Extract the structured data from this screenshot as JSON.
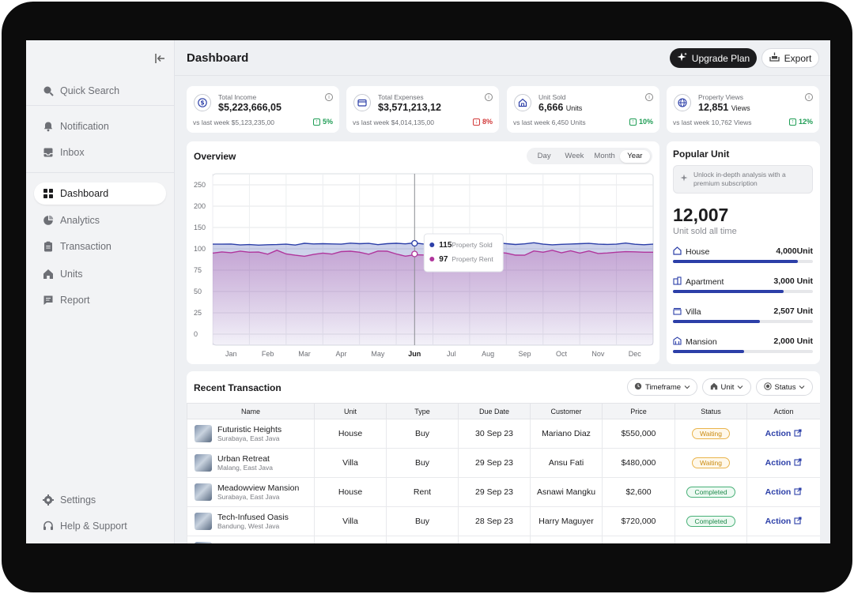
{
  "sidebar": {
    "items": [
      {
        "label": "Quick Search",
        "icon": "search-icon"
      },
      {
        "label": "Notification",
        "icon": "bell-icon"
      },
      {
        "label": "Inbox",
        "icon": "inbox-icon"
      },
      {
        "label": "Dashboard",
        "icon": "grid-icon",
        "active": true
      },
      {
        "label": "Analytics",
        "icon": "pie-chart-icon"
      },
      {
        "label": "Transaction",
        "icon": "clipboard-icon"
      },
      {
        "label": "Units",
        "icon": "home-icon"
      },
      {
        "label": "Report",
        "icon": "message-icon"
      }
    ],
    "footer": [
      {
        "label": "Settings",
        "icon": "gear-icon"
      },
      {
        "label": "Help & Support",
        "icon": "headset-icon"
      }
    ]
  },
  "header": {
    "title": "Dashboard",
    "upgrade_label": "Upgrade Plan",
    "export_label": "Export"
  },
  "stats": [
    {
      "label": "Total Income",
      "value": "$5,223,666,05",
      "unit": "",
      "compare": "vs last week $5,123,235,00",
      "change": "5%",
      "direction": "up",
      "icon": "dollar-icon"
    },
    {
      "label": "Total Expenses",
      "value": "$3,571,213,12",
      "unit": "",
      "compare": "vs last week $4,014,135,00",
      "change": "8%",
      "direction": "down",
      "icon": "wallet-icon"
    },
    {
      "label": "Unit Sold",
      "value": "6,666",
      "unit": "Units",
      "compare": "vs last week 6,450 Units",
      "change": "10%",
      "direction": "up",
      "icon": "house-icon"
    },
    {
      "label": "Property Views",
      "value": "12,851",
      "unit": "Views",
      "compare": "vs last week 10,762 Views",
      "change": "12%",
      "direction": "up",
      "icon": "globe-icon"
    }
  ],
  "overview": {
    "title": "Overview",
    "timeframes": [
      "Day",
      "Week",
      "Month",
      "Year"
    ],
    "active_timeframe": "Year",
    "tooltip": {
      "sold_value": "115",
      "sold_label": "Property Sold",
      "rent_value": "97",
      "rent_label": "Property Rent"
    }
  },
  "chart_data": {
    "type": "area",
    "title": "Overview",
    "xlabel": "",
    "ylabel": "",
    "categories": [
      "Jan",
      "Feb",
      "Mar",
      "Apr",
      "May",
      "Jun",
      "Jul",
      "Aug",
      "Sep",
      "Oct",
      "Nov",
      "Dec"
    ],
    "yticks": [
      0,
      25,
      50,
      75,
      100,
      150,
      200,
      250
    ],
    "ylim": [
      0,
      250
    ],
    "grid": true,
    "highlight": "Jun",
    "colors": {
      "sold": "#2c3fa8",
      "rent": "#b0359c"
    },
    "series": [
      {
        "name": "Property Sold",
        "values": [
          111,
          110,
          111,
          112,
          112,
          113,
          112,
          112,
          112,
          111,
          112,
          111
        ]
      },
      {
        "name": "Property Rent",
        "values": [
          95,
          96,
          94,
          95,
          96,
          94,
          95,
          96,
          95,
          96,
          95,
          96
        ]
      }
    ]
  },
  "popular": {
    "title": "Popular Unit",
    "promo": "Unlock in-depth analysis with a premium subscription",
    "total": "12,007",
    "total_label": "Unit sold all time",
    "units": [
      {
        "name": "House",
        "value": "4,000Unit",
        "fraction": 0.89,
        "icon": "house-icon"
      },
      {
        "name": "Apartment",
        "value": "3,000 Unit",
        "fraction": 0.79,
        "icon": "building-icon"
      },
      {
        "name": "Villa",
        "value": "2,507 Unit",
        "fraction": 0.62,
        "icon": "villa-icon"
      },
      {
        "name": "Mansion",
        "value": "2,000 Unit",
        "fraction": 0.51,
        "icon": "mansion-icon"
      }
    ]
  },
  "recent": {
    "title": "Recent Transaction",
    "filters": [
      "Timeframe",
      "Unit",
      "Status"
    ],
    "columns": [
      "Name",
      "Unit",
      "Type",
      "Due Date",
      "Customer",
      "Price",
      "Status",
      "Action"
    ],
    "rows": [
      {
        "name": "Futuristic Heights",
        "location": "Surabaya, East Java",
        "unit": "House",
        "type": "Buy",
        "due": "30 Sep 23",
        "customer": "Mariano Diaz",
        "price": "$550,000",
        "status": "Waiting",
        "action": "Action"
      },
      {
        "name": "Urban Retreat",
        "location": "Malang, East Java",
        "unit": "Villa",
        "type": "Buy",
        "due": "29 Sep 23",
        "customer": "Ansu Fati",
        "price": "$480,000",
        "status": "Waiting",
        "action": "Action"
      },
      {
        "name": "Meadowview Mansion",
        "location": "Surabaya, East Java",
        "unit": "House",
        "type": "Rent",
        "due": "29 Sep 23",
        "customer": "Asnawi Mangku",
        "price": "$2,600",
        "status": "Completed",
        "action": "Action"
      },
      {
        "name": "Tech-Infused Oasis",
        "location": "Bandung, West Java",
        "unit": "Villa",
        "type": "Buy",
        "due": "28 Sep 23",
        "customer": "Harry Maguyer",
        "price": "$720,000",
        "status": "Completed",
        "action": "Action"
      }
    ]
  }
}
